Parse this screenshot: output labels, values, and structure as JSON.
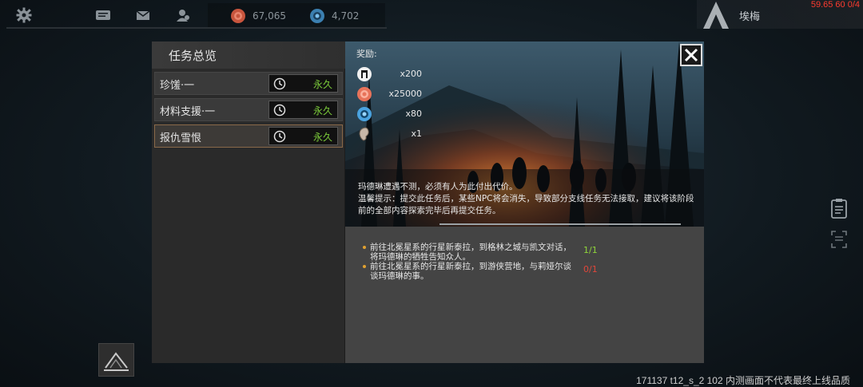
{
  "topbar": {
    "icons": [
      "gear-icon",
      "chat-icon",
      "mail-icon",
      "friends-icon"
    ],
    "resource1": {
      "icon": "gold-coin-icon",
      "value": "67,065",
      "color": "#c8553d"
    },
    "resource2": {
      "icon": "gem-icon",
      "value": "4,702",
      "color": "#3b7fb0"
    },
    "player_name": "埃梅",
    "fps": "59.65 60 0/4"
  },
  "panel": {
    "title": "任务总览",
    "quests": [
      {
        "name": "珍馐·一",
        "duration": "永久"
      },
      {
        "name": "材料支援·一",
        "duration": "永久"
      },
      {
        "name": "报仇雪恨",
        "duration": "永久",
        "selected": true
      }
    ],
    "reward_label": "奖励:",
    "rewards": [
      {
        "icon": "reputation-icon",
        "amount": "x200"
      },
      {
        "icon": "gold-coin-icon",
        "amount": "x25000"
      },
      {
        "icon": "gem-icon",
        "amount": "x80"
      },
      {
        "icon": "ear-item-icon",
        "amount": "x1"
      }
    ],
    "description_line1": "玛德琳遭遇不测，必须有人为此付出代价。",
    "description_line2": "温馨提示：提交此任务后，某些NPC将会消失，导致部分支线任务无法接取，建议将该阶段前的全部内容探索完毕后再提交任务。",
    "objectives": [
      {
        "text": "前往北冕星系的行星新泰拉，到格林之城与凯文对话，将玛德琳的牺牲告知众人。",
        "progress": "1/1",
        "color": "#8fd43a"
      },
      {
        "text": "前往北冕星系的行星新泰拉，到游侠营地，与莉娅尔谈谈玛德琳的事。",
        "progress": "0/1",
        "color": "#e0463a"
      }
    ]
  },
  "footer": "171137 t12_s_2 102  内测画面不代表最终上线品质"
}
